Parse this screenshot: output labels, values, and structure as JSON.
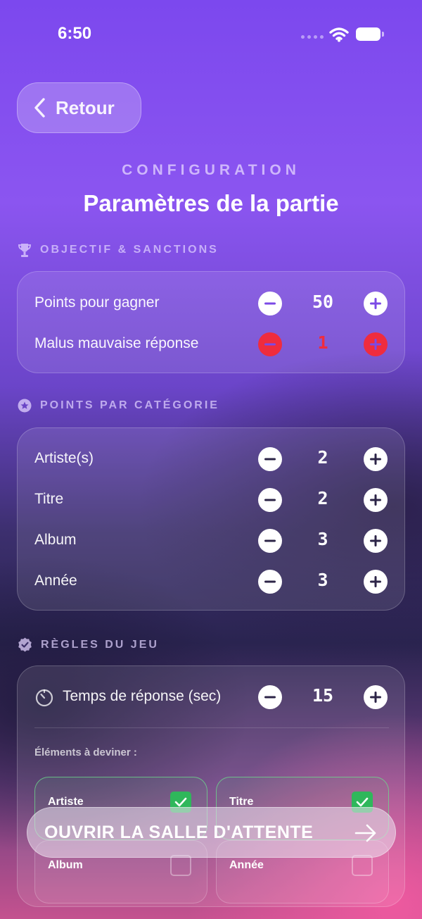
{
  "status_bar": {
    "time": "6:50"
  },
  "header": {
    "back_label": "Retour",
    "overline": "CONFIGURATION",
    "title": "Paramètres de la partie"
  },
  "sections": {
    "objective": {
      "heading": "OBJECTIF & SANCTIONS",
      "icon": "trophy-icon",
      "rows": [
        {
          "label": "Points pour gagner",
          "value": "50"
        },
        {
          "label": "Malus mauvaise réponse",
          "value": "1"
        }
      ]
    },
    "categories": {
      "heading": "POINTS PAR CATÉGORIE",
      "icon": "star-badge-icon",
      "rows": [
        {
          "label": "Artiste(s)",
          "value": "2"
        },
        {
          "label": "Titre",
          "value": "2"
        },
        {
          "label": "Album",
          "value": "3"
        },
        {
          "label": "Année",
          "value": "3"
        }
      ]
    },
    "rules": {
      "heading": "RÈGLES DU JEU",
      "icon": "check-badge-icon",
      "timer": {
        "label": "Temps de réponse (sec)",
        "value": "15"
      },
      "guess_label": "Éléments à deviner :",
      "guess_items": [
        {
          "label": "Artiste",
          "checked": true
        },
        {
          "label": "Titre",
          "checked": true
        },
        {
          "label": "Album",
          "checked": false
        },
        {
          "label": "Année",
          "checked": false
        }
      ]
    }
  },
  "cta": {
    "label": "OUVRIR LA SALLE D'ATTENTE"
  },
  "colors": {
    "accent_red": "#ef2c3e",
    "check_green": "#2fb75b",
    "minus_plus_icon": "#7b4ae6"
  }
}
